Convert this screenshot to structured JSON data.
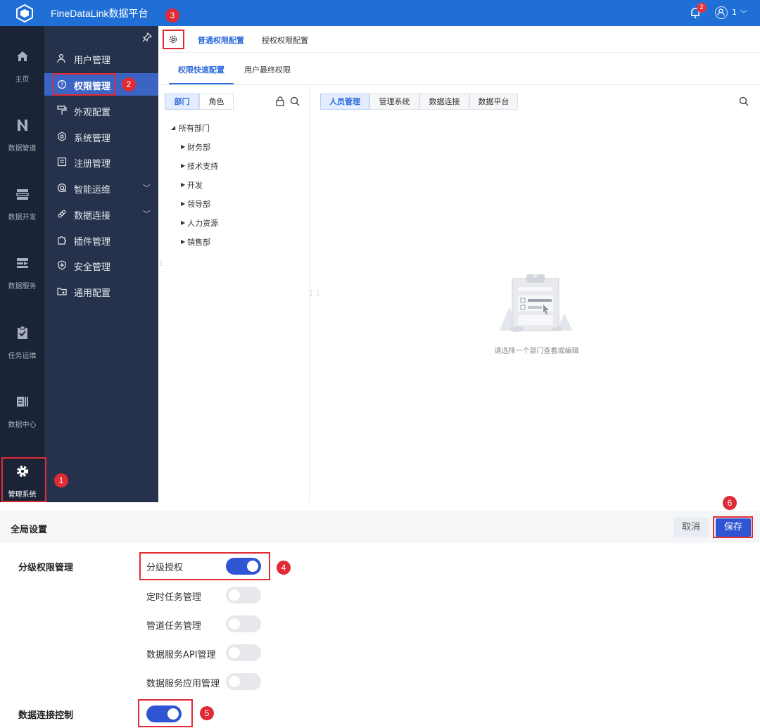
{
  "app": {
    "title": "FineDataLink数据平台",
    "notification_count": "2",
    "user_name": "1"
  },
  "rail": [
    {
      "label": "主页",
      "icon": "home-icon"
    },
    {
      "label": "数据管道",
      "icon": "pipeline-icon"
    },
    {
      "label": "数据开发",
      "icon": "dev-icon"
    },
    {
      "label": "数据服务",
      "icon": "service-icon"
    },
    {
      "label": "任务运维",
      "icon": "task-icon"
    },
    {
      "label": "数据中心",
      "icon": "datacenter-icon"
    },
    {
      "label": "管理系统",
      "icon": "gear-icon"
    }
  ],
  "sidebar": {
    "items": [
      {
        "label": "用户管理"
      },
      {
        "label": "权限管理"
      },
      {
        "label": "外观配置"
      },
      {
        "label": "系统管理"
      },
      {
        "label": "注册管理"
      },
      {
        "label": "智能运维"
      },
      {
        "label": "数据连接"
      },
      {
        "label": "插件管理"
      },
      {
        "label": "安全管理"
      },
      {
        "label": "通用配置"
      }
    ]
  },
  "tabs": {
    "tab1": "普通权限配置",
    "tab2": "授权权限配置"
  },
  "subtabs": {
    "st1": "权限快速配置",
    "st2": "用户最终权限"
  },
  "tree": {
    "seg_dept": "部门",
    "seg_role": "角色",
    "root": "所有部门",
    "children": [
      "财务部",
      "技术支持",
      "开发",
      "领导部",
      "人力资源",
      "销售部"
    ]
  },
  "right": {
    "tabs": [
      "人员管理",
      "管理系统",
      "数据连接",
      "数据平台"
    ],
    "empty_text": "请选择一个部门查看或编辑"
  },
  "settings": {
    "title": "全局设置",
    "cancel": "取消",
    "save": "保存",
    "group1": "分级权限管理",
    "options": [
      {
        "label": "分级授权",
        "on": true
      },
      {
        "label": "定时任务管理",
        "on": false
      },
      {
        "label": "管道任务管理",
        "on": false
      },
      {
        "label": "数据服务API管理",
        "on": false
      },
      {
        "label": "数据服务应用管理",
        "on": false
      }
    ],
    "group2": "数据连接控制",
    "group2_on": true
  },
  "annotations": [
    "1",
    "2",
    "3",
    "4",
    "5",
    "6"
  ],
  "colors": {
    "primary": "#1f6fd6",
    "accent": "#2f55d4",
    "annotation": "#e02b35",
    "rail": "#1b2336",
    "sidebar": "#26324b"
  }
}
